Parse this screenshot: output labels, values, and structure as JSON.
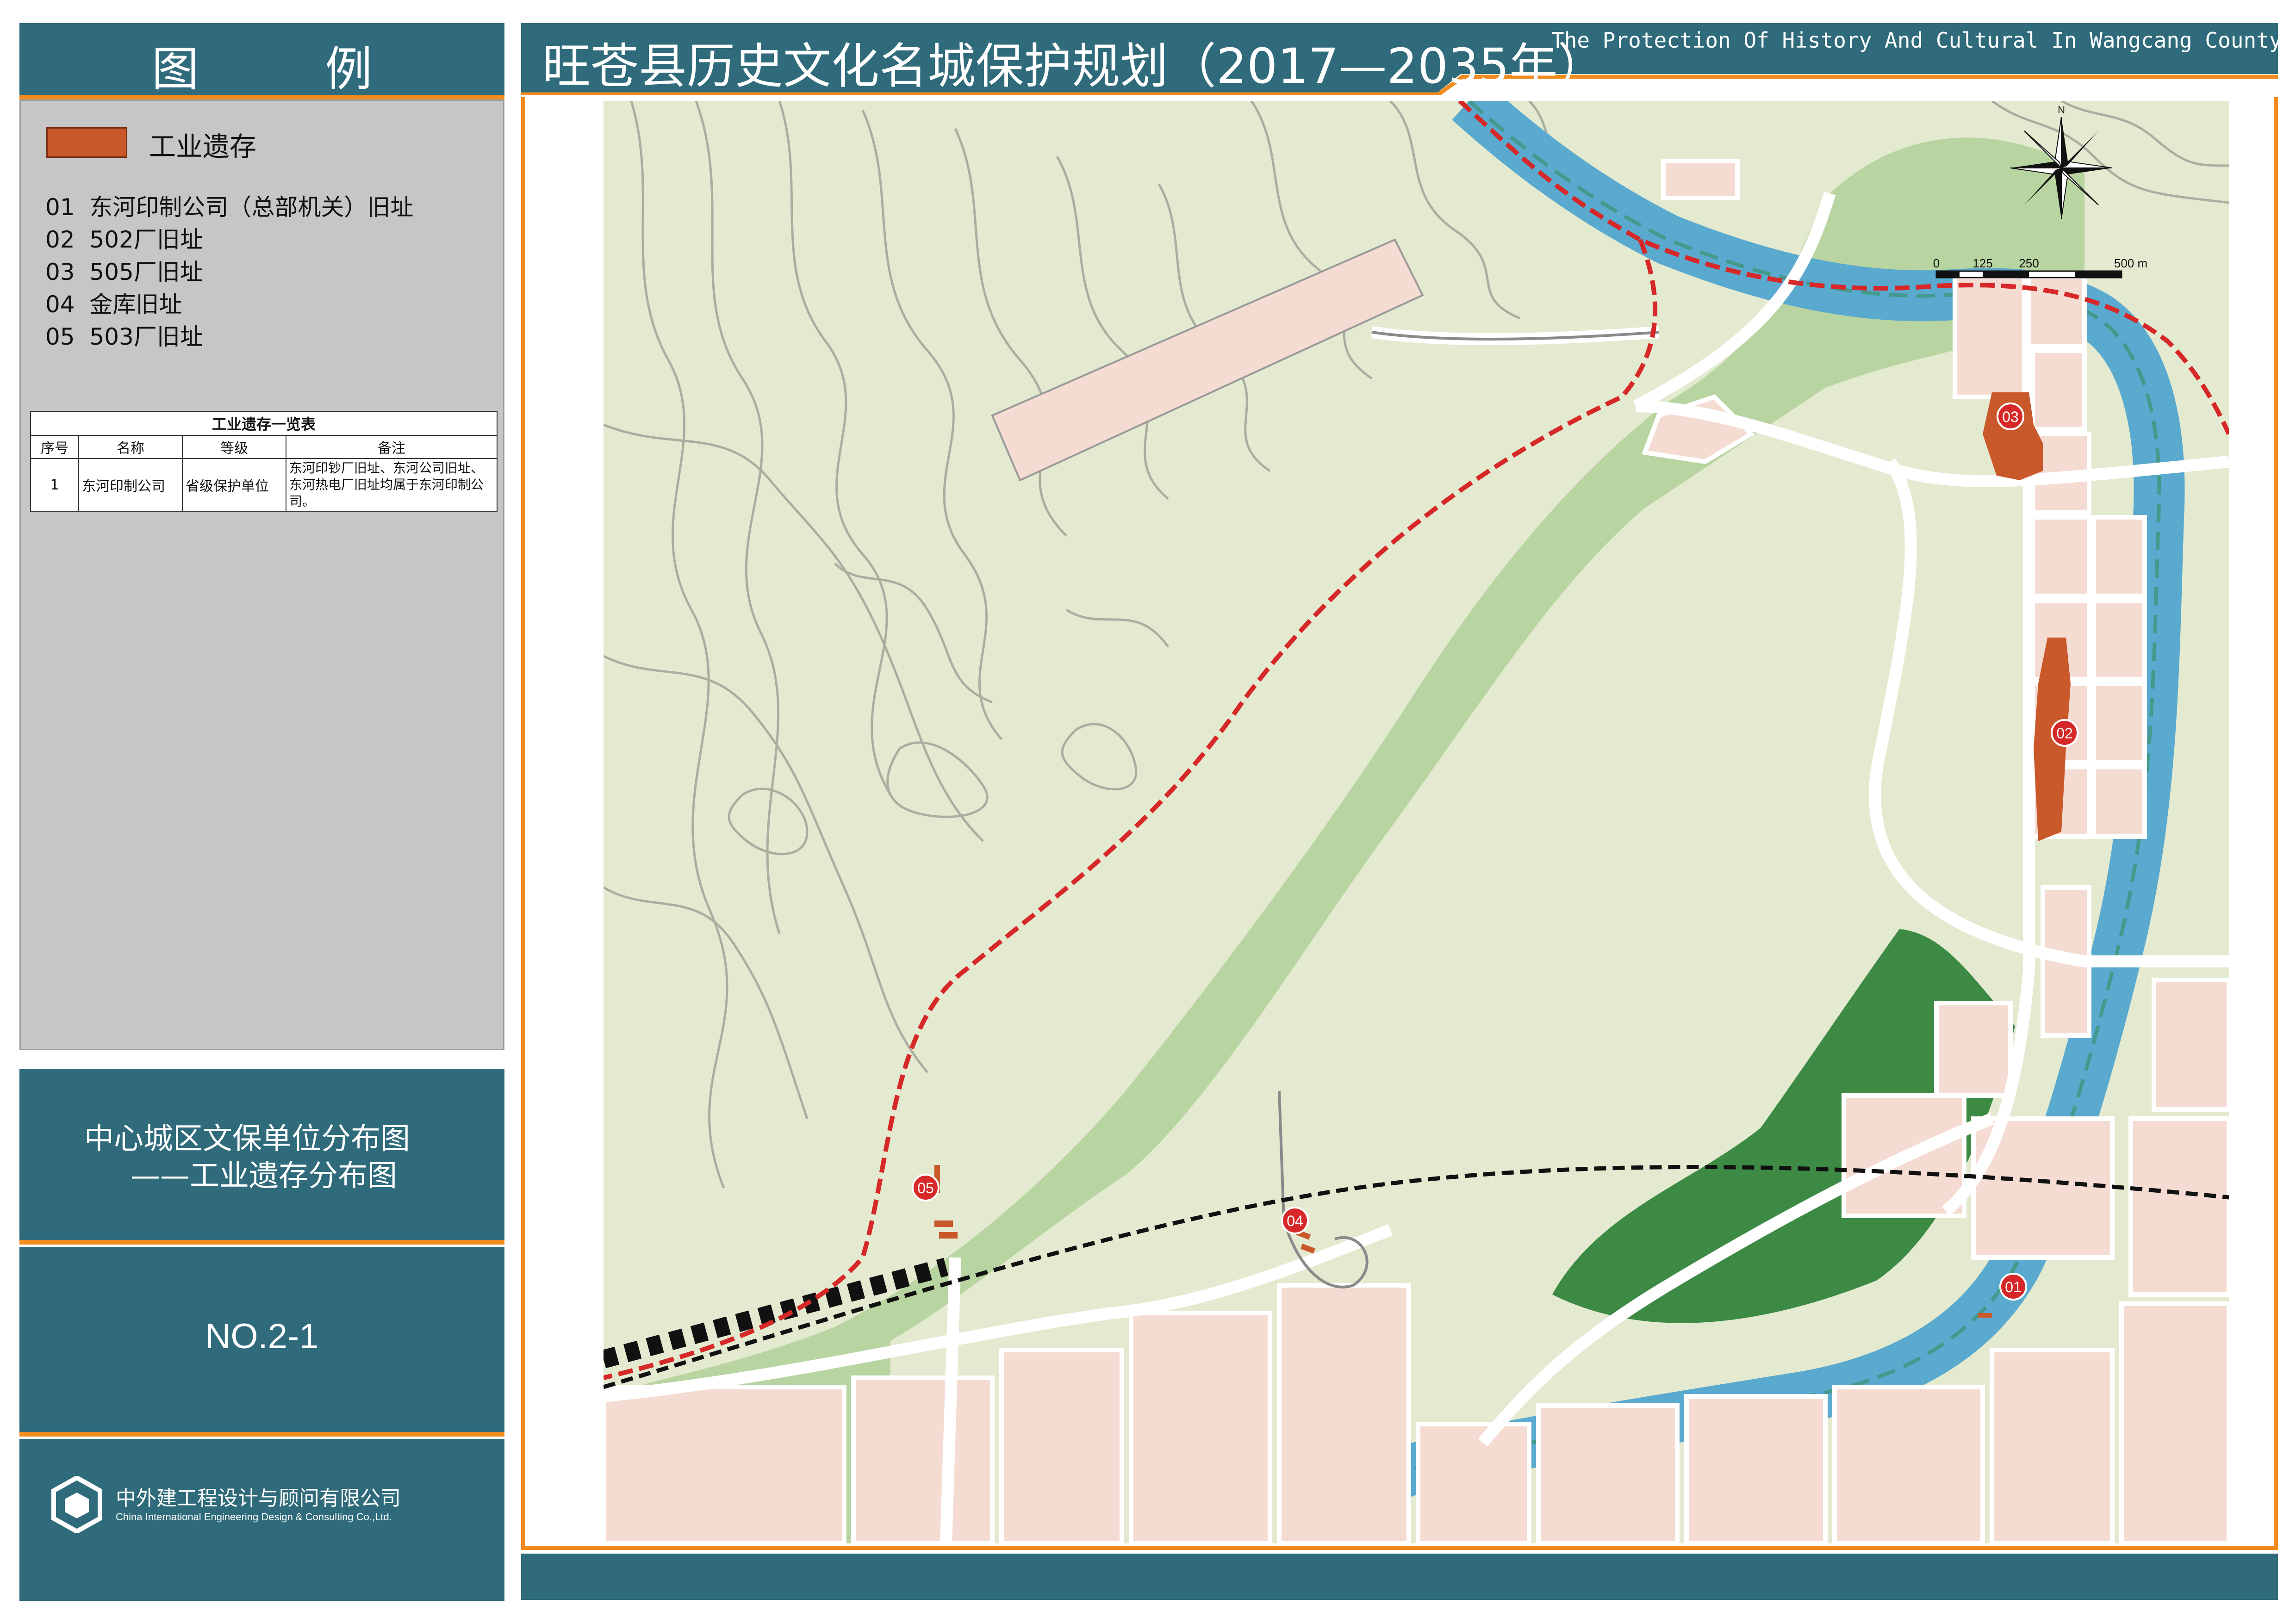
{
  "legend": {
    "title": "图 例",
    "key_label": "工业遗存",
    "key_color": "#c9592b",
    "sites": [
      {
        "num": "01",
        "name": "东河印制公司（总部机关）旧址"
      },
      {
        "num": "02",
        "name": "502厂旧址"
      },
      {
        "num": "03",
        "name": "505厂旧址"
      },
      {
        "num": "04",
        "name": "金库旧址"
      },
      {
        "num": "05",
        "name": "503厂旧址"
      }
    ],
    "table": {
      "caption": "工业遗存一览表",
      "headers": [
        "序号",
        "名称",
        "等级",
        "备注"
      ],
      "rows": [
        [
          "1",
          "东河印制公司",
          "省级保护单位",
          "东河印钞厂旧址、东河公司旧址、东河热电厂旧址均属于东河印制公司。"
        ]
      ]
    }
  },
  "sheet": {
    "title_line1": "中心城区文保单位分布图",
    "title_line2": "——工业遗存分布图",
    "number": "NO.2-1"
  },
  "company": {
    "name_cn": "中外建工程设计与顾问有限公司",
    "name_en": "China International Engineering Design & Consulting Co.,Ltd."
  },
  "header": {
    "title": "旺苍县历史文化名城保护规划（2017—2035年）",
    "subtitle": "The Protection Of History And Cultural  In Wangcang County"
  },
  "map": {
    "scale_labels": [
      "0",
      "125",
      "250",
      "500  m"
    ],
    "markers": [
      "01",
      "02",
      "03",
      "04",
      "05"
    ],
    "colors": {
      "river": "#5aa9cf",
      "hill": "#e3ead0",
      "green": "#b8d4a0",
      "forest": "#3d8a45",
      "plot": "#f5dcd3",
      "heritage": "#c9592b",
      "marker": "#d62828",
      "boundary": "#d62828"
    }
  }
}
